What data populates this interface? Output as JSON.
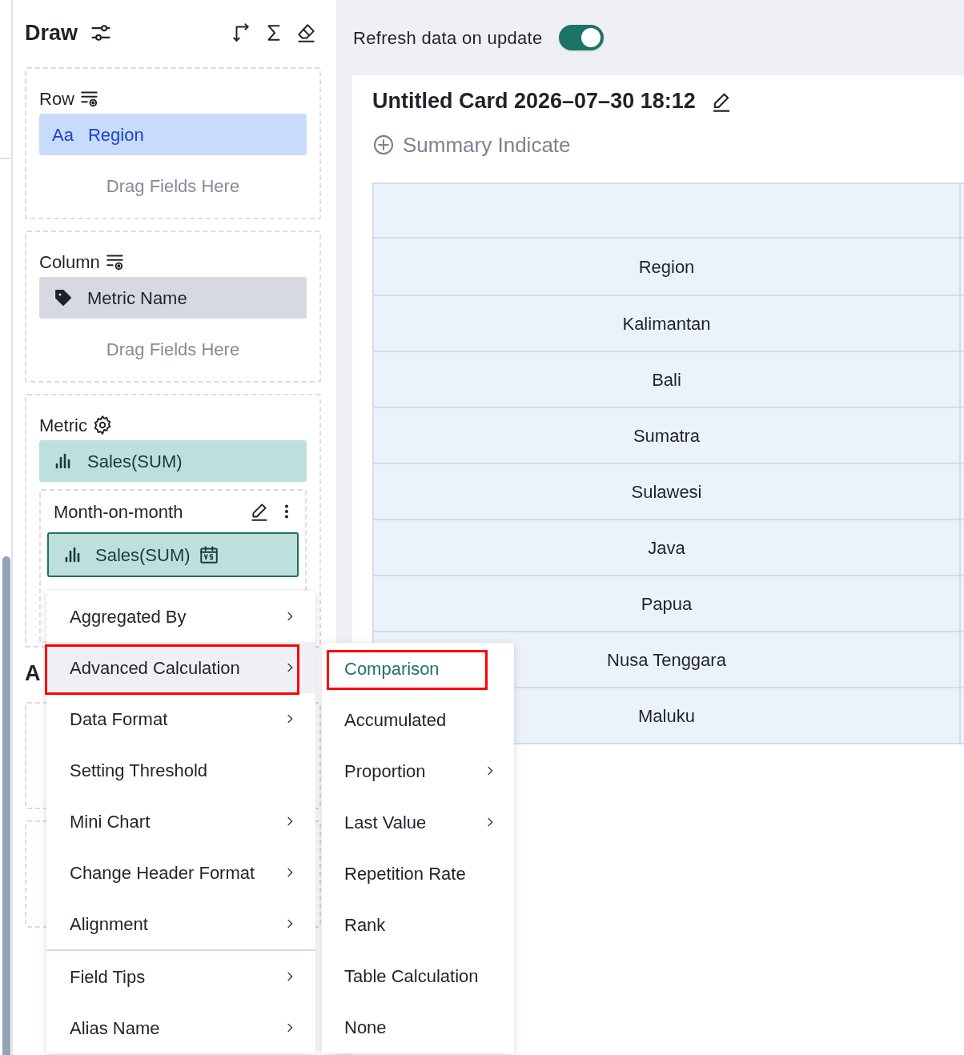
{
  "panel": {
    "title": "Draw"
  },
  "sections": [
    {
      "kind": "drop",
      "label": "Row",
      "fields": [
        {
          "kind": "dimension",
          "icon_text": "Aa",
          "name": "Region"
        }
      ],
      "placeholder": "Drag Fields Here"
    },
    {
      "kind": "drop",
      "label": "Column",
      "fields": [
        {
          "kind": "tag",
          "name": "Metric Name"
        }
      ],
      "placeholder": "Drag Fields Here"
    },
    {
      "kind": "metric",
      "label": "Metric",
      "fields": [
        {
          "kind": "measure",
          "name": "Sales(SUM)"
        }
      ],
      "calculation": {
        "title": "Month-on-month",
        "field": "Sales(SUM)"
      }
    }
  ],
  "hidden_heading": "A",
  "refresh": {
    "label": "Refresh data on update",
    "on": true
  },
  "card": {
    "title": "Untitled Card 2026–07–30 18:12",
    "summary": "Summary Indicate",
    "table": {
      "row_header": "Region",
      "rows": [
        "Kalimantan",
        "Bali",
        "Sumatra",
        "Sulawesi",
        "Java",
        "Papua",
        "Nusa Tenggara",
        "Maluku"
      ]
    }
  },
  "context_menu": [
    {
      "label": "Aggregated By",
      "submenu": true,
      "hovered": false,
      "annotated": false,
      "divider_before": false
    },
    {
      "label": "Advanced Calculation",
      "submenu": true,
      "hovered": true,
      "annotated": true,
      "divider_before": false
    },
    {
      "label": "Data Format",
      "submenu": true,
      "hovered": false,
      "annotated": false,
      "divider_before": false
    },
    {
      "label": "Setting Threshold",
      "submenu": false,
      "hovered": false,
      "annotated": false,
      "divider_before": false
    },
    {
      "label": "Mini Chart",
      "submenu": true,
      "hovered": false,
      "annotated": false,
      "divider_before": false
    },
    {
      "label": "Change Header Format",
      "submenu": true,
      "hovered": false,
      "annotated": false,
      "divider_before": false
    },
    {
      "label": "Alignment",
      "submenu": true,
      "hovered": false,
      "annotated": false,
      "divider_before": false
    },
    {
      "label": "Field Tips",
      "submenu": true,
      "hovered": false,
      "annotated": false,
      "divider_before": true
    },
    {
      "label": "Alias Name",
      "submenu": true,
      "hovered": false,
      "annotated": false,
      "divider_before": false
    }
  ],
  "submenu": [
    {
      "label": "Comparison",
      "submenu": false,
      "selected": true,
      "annotated": true
    },
    {
      "label": "Accumulated",
      "submenu": false,
      "selected": false,
      "annotated": false
    },
    {
      "label": "Proportion",
      "submenu": true,
      "selected": false,
      "annotated": false
    },
    {
      "label": "Last Value",
      "submenu": true,
      "selected": false,
      "annotated": false
    },
    {
      "label": "Repetition Rate",
      "submenu": false,
      "selected": false,
      "annotated": false
    },
    {
      "label": "Rank",
      "submenu": false,
      "selected": false,
      "annotated": false
    },
    {
      "label": "Table Calculation",
      "submenu": false,
      "selected": false,
      "annotated": false
    },
    {
      "label": "None",
      "submenu": false,
      "selected": false,
      "annotated": false
    }
  ]
}
